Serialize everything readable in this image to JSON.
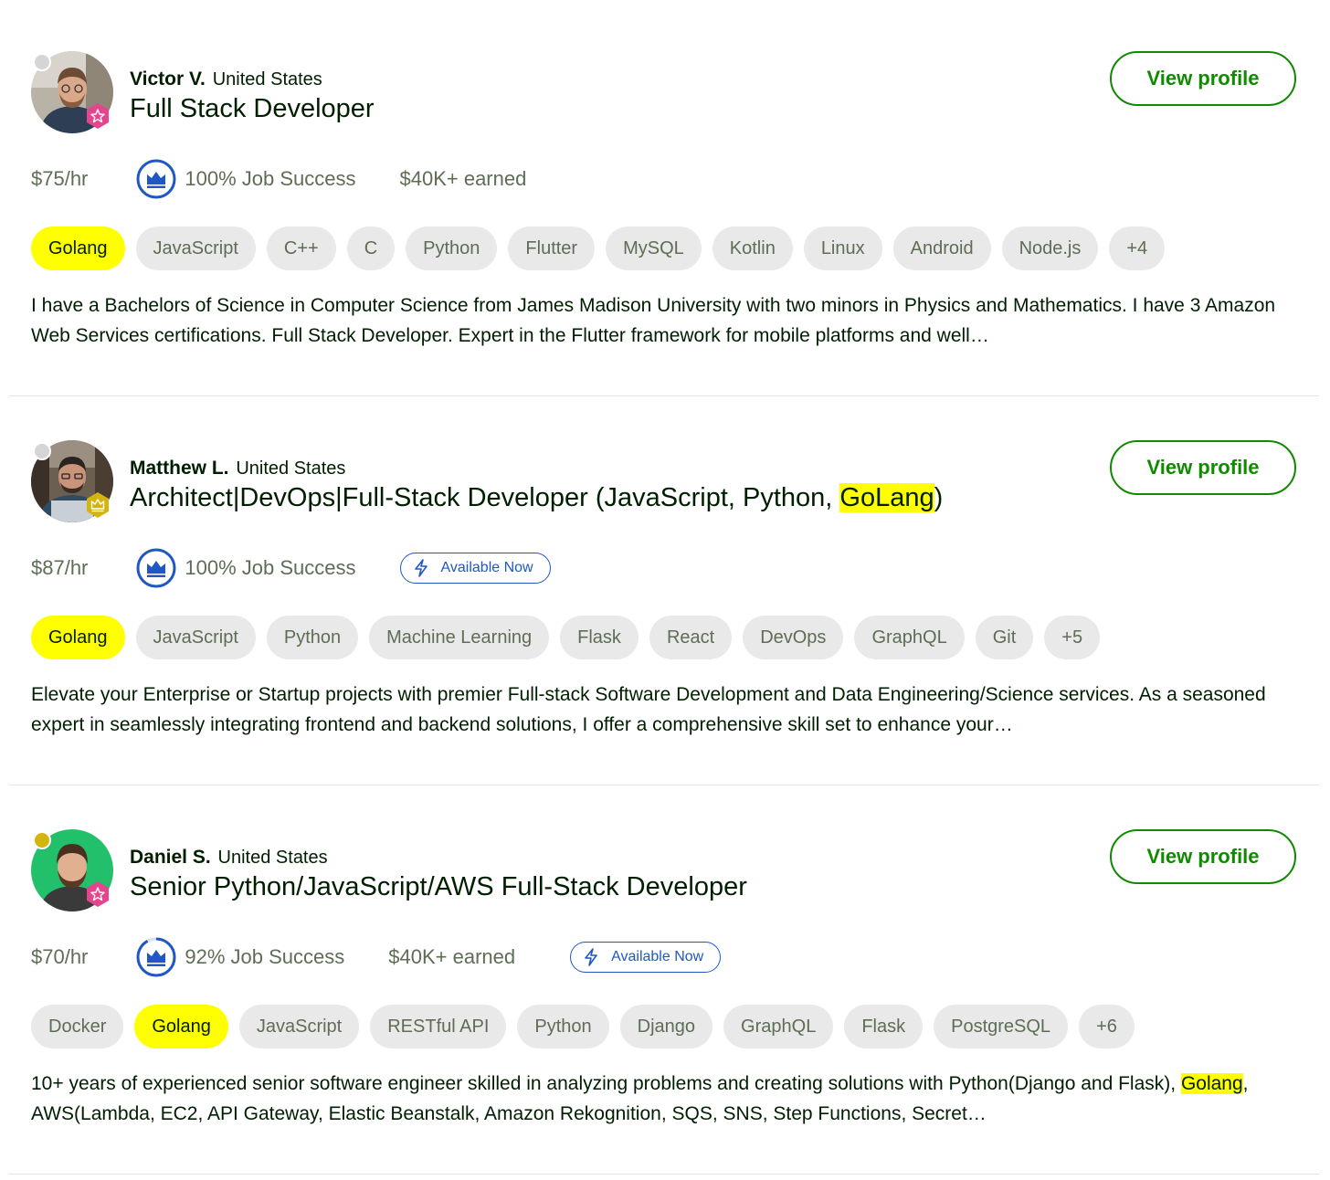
{
  "freelancers": [
    {
      "name": "Victor V.",
      "country": "United States",
      "title_pre": "Full Stack Developer",
      "title_hl": "",
      "title_post": "",
      "rate": "$75/hr",
      "job_success": "100% Job Success",
      "job_success_percent": 100,
      "earned": "$40K+ earned",
      "available": "",
      "status_color": "#d5d5d5",
      "badge": "top-rated-star-icon",
      "skills": [
        {
          "label": "Golang",
          "highlight": true
        },
        {
          "label": "JavaScript",
          "highlight": false
        },
        {
          "label": "C++",
          "highlight": false
        },
        {
          "label": "C",
          "highlight": false
        },
        {
          "label": "Python",
          "highlight": false
        },
        {
          "label": "Flutter",
          "highlight": false
        },
        {
          "label": "MySQL",
          "highlight": false
        },
        {
          "label": "Kotlin",
          "highlight": false
        },
        {
          "label": "Linux",
          "highlight": false
        },
        {
          "label": "Android",
          "highlight": false
        },
        {
          "label": "Node.js",
          "highlight": false
        },
        {
          "label": "+4",
          "highlight": false
        }
      ],
      "desc_pre": "I have a Bachelors of Science in Computer Science from James Madison University with two minors in Physics and Mathematics. I have 3 Amazon Web Services certifications. Full Stack Developer. Expert in the Flutter framework for mobile platforms and well…",
      "desc_hl": "",
      "desc_post": "",
      "view_label": "View profile"
    },
    {
      "name": "Matthew L.",
      "country": "United States",
      "title_pre": "Architect|DevOps|Full-Stack Developer (JavaScript, Python, ",
      "title_hl": "GoLang",
      "title_post": ")",
      "rate": "$87/hr",
      "job_success": "100% Job Success",
      "job_success_percent": 100,
      "earned": "",
      "available": "Available Now",
      "status_color": "#d5d5d5",
      "badge": "expert-vetted-crown-icon",
      "skills": [
        {
          "label": "Golang",
          "highlight": true
        },
        {
          "label": "JavaScript",
          "highlight": false
        },
        {
          "label": "Python",
          "highlight": false
        },
        {
          "label": "Machine Learning",
          "highlight": false
        },
        {
          "label": "Flask",
          "highlight": false
        },
        {
          "label": "React",
          "highlight": false
        },
        {
          "label": "DevOps",
          "highlight": false
        },
        {
          "label": "GraphQL",
          "highlight": false
        },
        {
          "label": "Git",
          "highlight": false
        },
        {
          "label": "+5",
          "highlight": false
        }
      ],
      "desc_pre": "Elevate your Enterprise or Startup projects with premier Full-stack Software Development and Data Engineering/Science services. As a seasoned expert in seamlessly integrating frontend and backend solutions, I offer a comprehensive skill set to enhance your…",
      "desc_hl": "",
      "desc_post": "",
      "view_label": "View profile"
    },
    {
      "name": "Daniel S.",
      "country": "United States",
      "title_pre": "Senior Python/JavaScript/AWS Full-Stack Developer",
      "title_hl": "",
      "title_post": "",
      "rate": "$70/hr",
      "job_success": "92% Job Success",
      "job_success_percent": 92,
      "earned": "$40K+ earned",
      "available": "Available Now",
      "status_color": "#d4b40f",
      "badge": "top-rated-star-icon",
      "skills": [
        {
          "label": "Docker",
          "highlight": false
        },
        {
          "label": "Golang",
          "highlight": true
        },
        {
          "label": "JavaScript",
          "highlight": false
        },
        {
          "label": "RESTful API",
          "highlight": false
        },
        {
          "label": "Python",
          "highlight": false
        },
        {
          "label": "Django",
          "highlight": false
        },
        {
          "label": "GraphQL",
          "highlight": false
        },
        {
          "label": "Flask",
          "highlight": false
        },
        {
          "label": "PostgreSQL",
          "highlight": false
        },
        {
          "label": "+6",
          "highlight": false
        }
      ],
      "desc_pre": "10+ years of experienced senior software engineer skilled in analyzing problems and creating solutions with Python(Django and Flask), ",
      "desc_hl": "Golang",
      "desc_post": ", AWS(Lambda, EC2, API Gateway, Elastic Beanstalk, Amazon Rekognition, SQS, SNS, Step Functions, Secret…",
      "view_label": "View profile"
    }
  ],
  "colors": {
    "accent_green": "#108a00",
    "highlight_yellow": "#ffff00",
    "available_blue": "#1f57c3",
    "muted_text": "#5e6d55"
  }
}
